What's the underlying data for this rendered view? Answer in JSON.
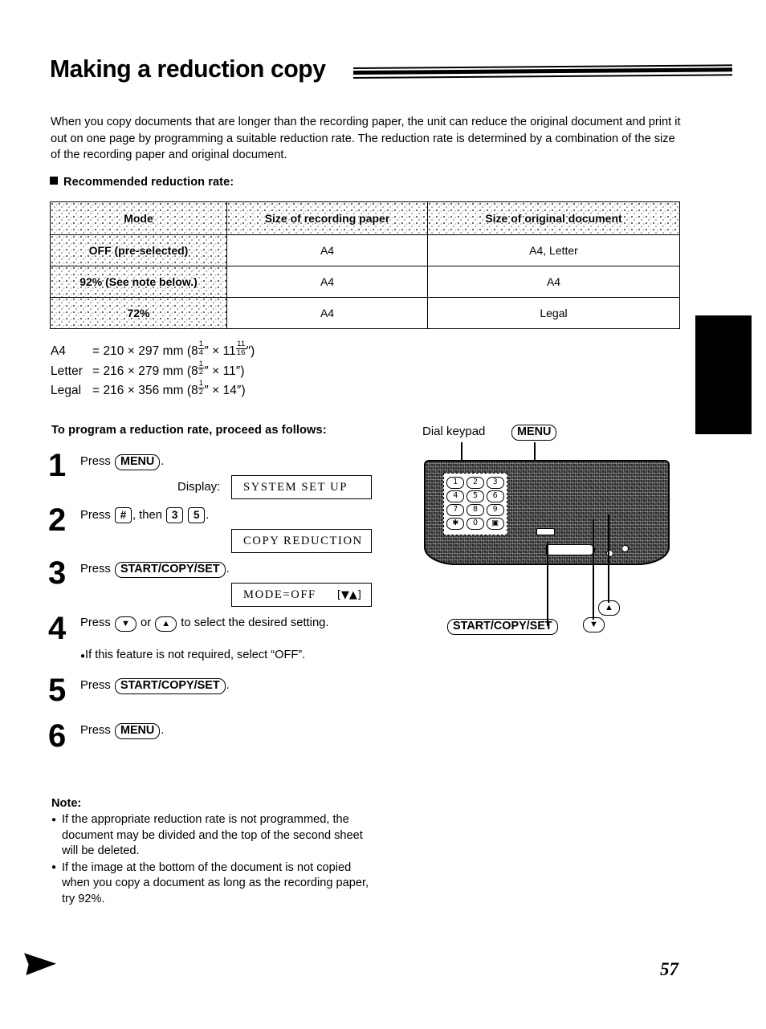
{
  "page": {
    "title": "Making a reduction copy",
    "number": "57",
    "intro": "When you copy documents that are longer than the recording paper, the unit can reduce the original document and print it out on one page by programming a suitable reduction rate. The reduction rate is determined by a combination of the size of the recording paper and original document."
  },
  "section": {
    "heading": "Recommended reduction rate:"
  },
  "table": {
    "headers": [
      "Mode",
      "Size of recording paper",
      "Size of original document"
    ],
    "rows": [
      {
        "mode": "OFF (pre-selected)",
        "recording_paper": "A4",
        "original_document": "A4, Letter"
      },
      {
        "mode": "92% (See note below.)",
        "recording_paper": "A4",
        "original_document": "A4"
      },
      {
        "mode": "72%",
        "recording_paper": "A4",
        "original_document": "Legal"
      }
    ]
  },
  "paper_sizes": [
    {
      "label": "A4",
      "eq": "=",
      "metric": "210 × 297 mm",
      "inch_prefix": "(8",
      "inch_frac_num": "1",
      "inch_frac_den": "4",
      "inch_mid": "″ × 11",
      "inch_sup_num": "11",
      "inch_sup_den": "16",
      "inch_suffix": "″)"
    },
    {
      "label": "Letter",
      "eq": "=",
      "metric": "216 × 279 mm",
      "inch_prefix": "(8",
      "inch_frac_num": "1",
      "inch_frac_den": "2",
      "inch_mid": "″ × 11",
      "inch_sup_num": "",
      "inch_sup_den": "",
      "inch_suffix": "″)"
    },
    {
      "label": "Legal",
      "eq": "=",
      "metric": "216 × 356 mm",
      "inch_prefix": "(8",
      "inch_frac_num": "1",
      "inch_frac_den": "2",
      "inch_mid": "″ × 14",
      "inch_sup_num": "",
      "inch_sup_den": "",
      "inch_suffix": "″)"
    }
  ],
  "procedure": {
    "heading": "To program a reduction rate, proceed as follows:",
    "steps": [
      {
        "num": "1",
        "press": "Press",
        "key": "MENU",
        "tail": "."
      },
      {
        "num": "2",
        "press": "Press",
        "key": "#",
        "mid": ", then",
        "key2": "3",
        "key3": "5",
        "tail": "."
      },
      {
        "num": "3",
        "press": "Press",
        "key": "START/COPY/SET",
        "tail": "."
      },
      {
        "num": "4",
        "press": "Press",
        "key": "▼",
        "mid": "or",
        "key2": "▲",
        "tail": "to select the desired setting.",
        "note": "If this feature is not required, select “OFF”."
      },
      {
        "num": "5",
        "press": "Press",
        "key": "START/COPY/SET",
        "tail": "."
      },
      {
        "num": "6",
        "press": "Press",
        "key": "MENU",
        "tail": "."
      }
    ],
    "display_label": "Display:",
    "displays": [
      {
        "text": "SYSTEM SET UP",
        "right": ""
      },
      {
        "text": "COPY REDUCTION",
        "right": ""
      },
      {
        "text": "MODE=OFF",
        "right": "[▼▲]"
      }
    ]
  },
  "illustration": {
    "callouts": {
      "dial_keypad": "Dial keypad",
      "menu": "MENU",
      "start_copy_set": "START/COPY/SET",
      "down": "▼",
      "up": "▲"
    },
    "keypad_keys": [
      [
        "1",
        "2",
        "3"
      ],
      [
        "4",
        "5",
        "6"
      ],
      [
        "7",
        "8",
        "9"
      ],
      [
        "✱",
        "0",
        "▣"
      ]
    ]
  },
  "note": {
    "heading": "Note:",
    "items": [
      "If the appropriate reduction rate is not programmed, the document may be divided and the top of the second sheet will be deleted.",
      "If the image at the bottom of the document is not copied when you copy a document as long as the recording paper, try 92%."
    ]
  }
}
